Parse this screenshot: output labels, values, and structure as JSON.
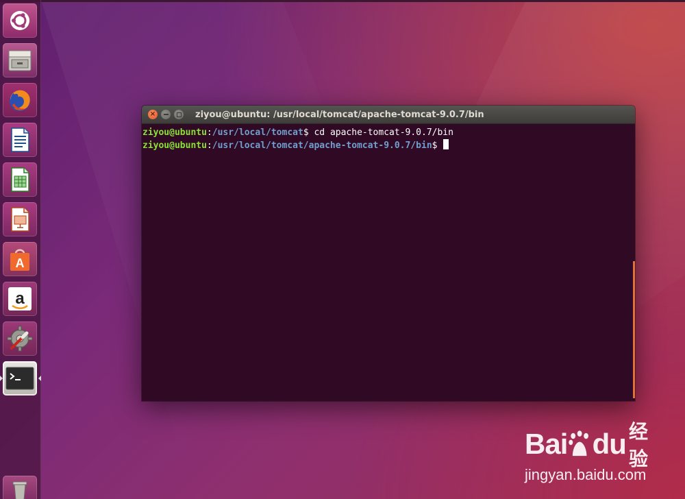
{
  "desktop": {
    "accent_color": "#e95420",
    "watermark": {
      "brand": "Bai",
      "brand_suffix": "du",
      "cn": "经验",
      "url": "jingyan.baidu.com"
    }
  },
  "launcher": {
    "items": [
      {
        "name": "ubuntu-dash",
        "icon": "ubuntu-logo-icon"
      },
      {
        "name": "files",
        "icon": "file-cabinet-icon"
      },
      {
        "name": "firefox",
        "icon": "firefox-icon"
      },
      {
        "name": "libreoffice-writer",
        "icon": "writer-document-icon"
      },
      {
        "name": "libreoffice-calc",
        "icon": "calc-spreadsheet-icon"
      },
      {
        "name": "libreoffice-impress",
        "icon": "impress-presentation-icon"
      },
      {
        "name": "ubuntu-software",
        "icon": "software-bag-icon"
      },
      {
        "name": "amazon",
        "icon": "amazon-icon"
      },
      {
        "name": "system-settings",
        "icon": "settings-wrench-icon"
      },
      {
        "name": "terminal",
        "icon": "terminal-icon",
        "active": true
      },
      {
        "name": "trash",
        "icon": "trash-icon"
      }
    ]
  },
  "terminal": {
    "title": "ziyou@ubuntu: /usr/local/tomcat/apache-tomcat-9.0.7/bin",
    "lines": [
      {
        "user": "ziyou@ubuntu",
        "sep": ":",
        "path": "/usr/local/tomcat",
        "prompt": "$ ",
        "command": "cd apache-tomcat-9.0.7/bin"
      },
      {
        "user": "ziyou@ubuntu",
        "sep": ":",
        "path": "/usr/local/tomcat/apache-tomcat-9.0.7/bin",
        "prompt": "$ ",
        "command": ""
      }
    ],
    "colors": {
      "background": "#300a24",
      "user": "#8ae234",
      "path": "#729fcf",
      "text": "#ffffff"
    }
  }
}
